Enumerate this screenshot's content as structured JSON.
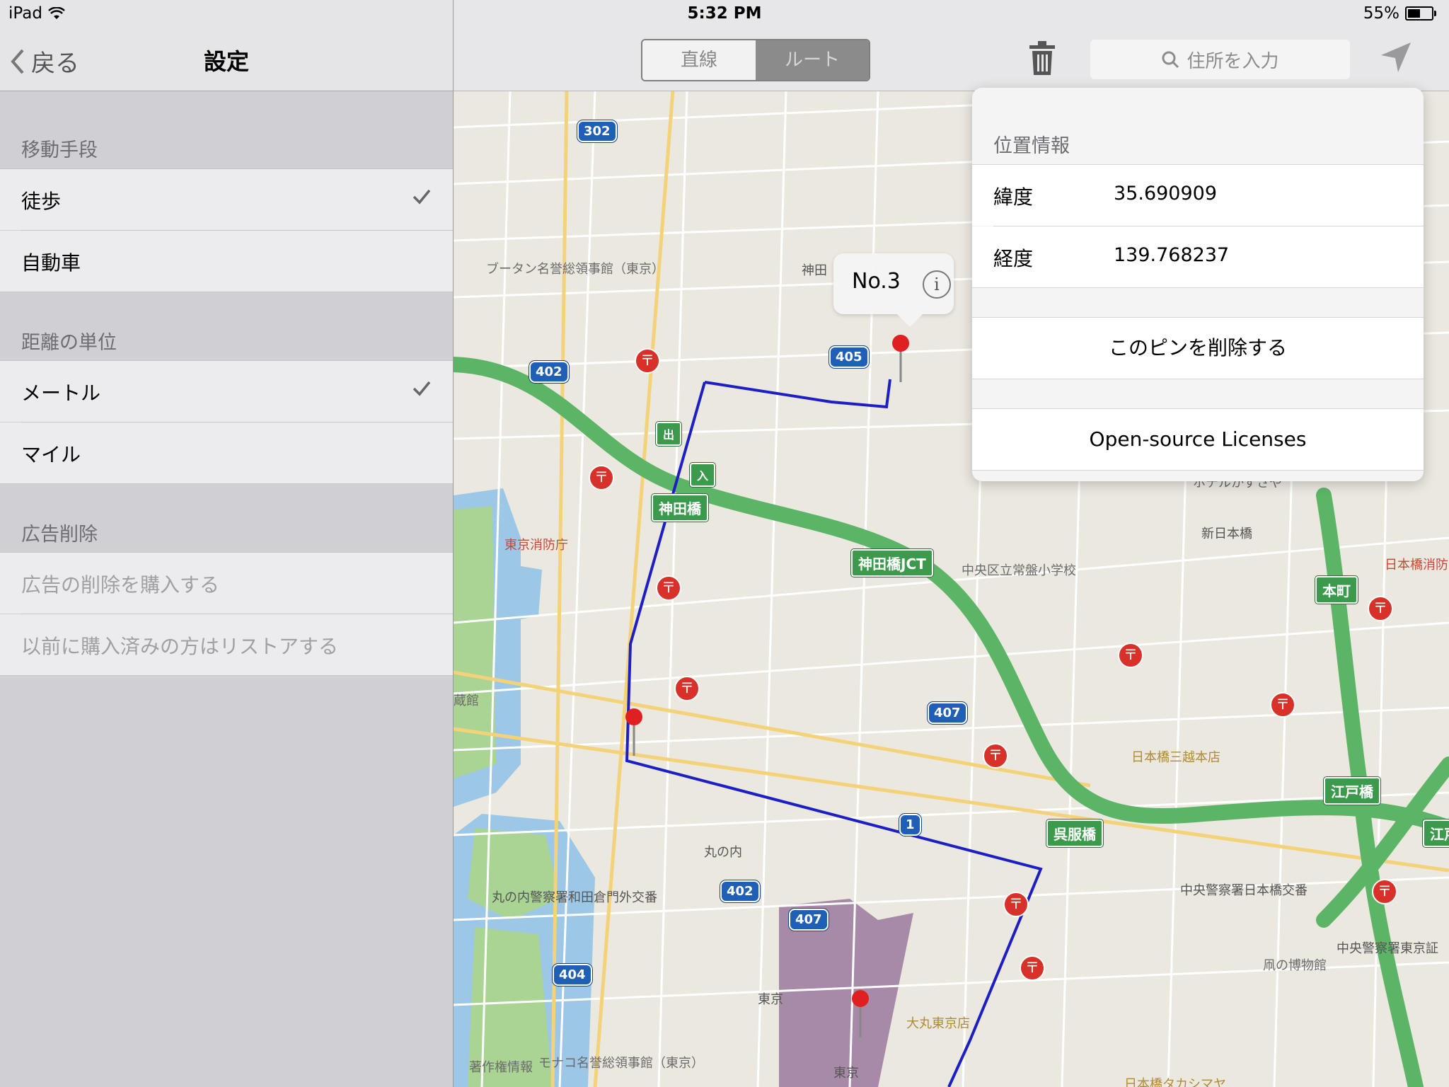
{
  "status": {
    "device": "iPad",
    "time": "5:32 PM",
    "battery": "55%",
    "battery_level": 0.55
  },
  "settings": {
    "back_label": "戻る",
    "title": "設定",
    "transport": {
      "header": "移動手段",
      "options": [
        "徒歩",
        "自動車"
      ],
      "selected": "徒歩"
    },
    "units": {
      "header": "距離の単位",
      "options": [
        "メートル",
        "マイル"
      ],
      "selected": "メートル"
    },
    "ads": {
      "header": "広告削除",
      "purchase": "広告の削除を購入する",
      "restore": "以前に購入済みの方はリストアする"
    }
  },
  "map_toolbar": {
    "mode_straight": "直線",
    "mode_route": "ルート",
    "search_placeholder": "住所を入力"
  },
  "callout": {
    "title": "No.3",
    "info_glyph": "i"
  },
  "popover": {
    "header": "位置情報",
    "latitude_label": "緯度",
    "latitude": "35.690909",
    "longitude_label": "経度",
    "longitude": "139.768237",
    "delete_pin": "このピンを削除する",
    "licenses": "Open-source Licenses"
  },
  "map": {
    "labels": {
      "bhutan": "ブータン名誉総領事館（東京）",
      "kandabashi_area": "神田",
      "fire_dept": "東京消防庁",
      "kanda_jct": "神田橋JCT",
      "school": "中央区立常盤小学校",
      "shin_nihonbashi": "新日本橋",
      "nihonbashi_edge": "日本橋消防",
      "mitsukoshi": "日本橋三越本店",
      "marunouchi": "丸の内",
      "police_wadakura": "丸の内警察署和田倉門外交番",
      "police_nihonbashi": "中央警察署日本橋交番",
      "police_tokyo": "中央警察署東京証",
      "coin_museum": "凧の博物館",
      "tokyo_station": "東京",
      "tokyo_station_bottom": "東京",
      "daimaru": "大丸東京店",
      "takashimaya": "日本橋タカシマヤ",
      "consulate_bottom": "モナコ名誉総領事館（東京）",
      "copyright": "著作権情報",
      "museum_edge": "蔵館",
      "hotel_edge": "ホテルかずさや"
    },
    "shields": {
      "r302": "302",
      "r402a": "402",
      "r405": "405",
      "r407a": "407",
      "r402b": "402",
      "r407b": "407",
      "r404": "404",
      "r1": "1"
    },
    "signs": {
      "kandabashi": "神田橋",
      "gofukubashi": "呉服橋",
      "honmachi": "本町",
      "edobashi": "江戸橋",
      "edo_edge": "江戸",
      "exit": "出",
      "enter": "入"
    }
  }
}
